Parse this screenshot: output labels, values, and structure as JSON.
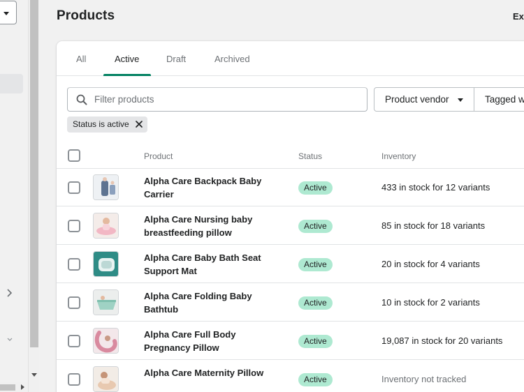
{
  "page": {
    "title": "Products",
    "export_label": "Exp"
  },
  "tabs": [
    {
      "label": "All",
      "selected": false
    },
    {
      "label": "Active",
      "selected": true
    },
    {
      "label": "Draft",
      "selected": false
    },
    {
      "label": "Archived",
      "selected": false
    }
  ],
  "search": {
    "placeholder": "Filter products",
    "value": ""
  },
  "filters": {
    "vendor_label": "Product vendor",
    "tagged_label": "Tagged w"
  },
  "applied_filter": {
    "label": "Status is active"
  },
  "table": {
    "headers": {
      "product": "Product",
      "status": "Status",
      "inventory": "Inventory"
    },
    "rows": [
      {
        "name": "Alpha Care Backpack Baby Carrier",
        "status": "Active",
        "inventory": "433 in stock for 12 variants",
        "thumb_icon": "baby-carrier-photo"
      },
      {
        "name": "Alpha Care Nursing baby breastfeeding pillow",
        "status": "Active",
        "inventory": "85 in stock for 18 variants",
        "thumb_icon": "nursing-pillow-photo"
      },
      {
        "name": "Alpha Care Baby Bath Seat Support Mat",
        "status": "Active",
        "inventory": "20 in stock for 4 variants",
        "thumb_icon": "bath-seat-photo"
      },
      {
        "name": "Alpha Care Folding Baby Bathtub",
        "status": "Active",
        "inventory": "10 in stock for 2 variants",
        "thumb_icon": "folding-bathtub-photo"
      },
      {
        "name": "Alpha Care Full Body Pregnancy Pillow",
        "status": "Active",
        "inventory": "19,087 in stock for 20 variants",
        "thumb_icon": "pregnancy-pillow-photo"
      },
      {
        "name": "Alpha Care Maternity Pillow",
        "status": "Active",
        "inventory": "Inventory not tracked",
        "thumb_icon": "maternity-pillow-photo"
      }
    ]
  },
  "colors": {
    "accent_tab_underline": "#008060",
    "active_badge_bg": "#aee9d1",
    "page_bg": "#f1f1f1"
  }
}
